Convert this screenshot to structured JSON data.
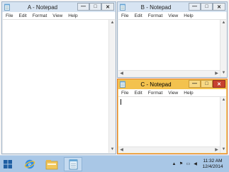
{
  "windows": {
    "a": {
      "title": "A - Notepad"
    },
    "b": {
      "title": "B - Notepad"
    },
    "c": {
      "title": "C - Notepad"
    }
  },
  "menu": [
    "File",
    "Edit",
    "Format",
    "View",
    "Help"
  ],
  "window_controls": {
    "minimize": "—",
    "maximize": "□",
    "close": "✕"
  },
  "taskbar": {
    "pinned": [
      "start-icon",
      "internet-explorer-icon",
      "file-explorer-icon",
      "notepad-icon"
    ],
    "tray_icons": [
      "chevron-up-icon",
      "flag-icon",
      "network-icon",
      "volume-icon"
    ],
    "clock": {
      "time": "11:32 AM",
      "date": "12/4/2014"
    }
  },
  "colors": {
    "active_title": "#f3c24e",
    "inactive_title": "#d7e4f2",
    "close_active": "#c7412f",
    "taskbar": "#a9c7e6"
  }
}
